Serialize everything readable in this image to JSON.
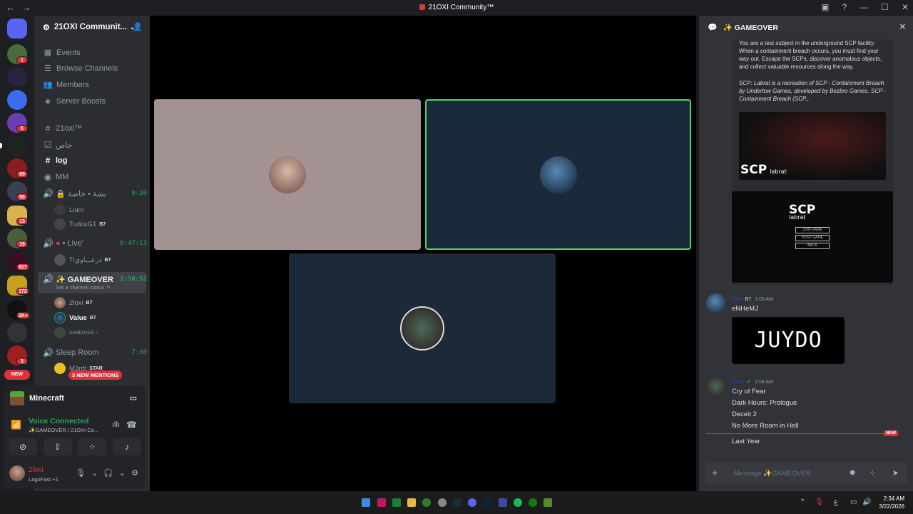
{
  "window": {
    "title": "21OXI Community™"
  },
  "guild_badges": [
    "1",
    "5",
    "69",
    "98",
    "13",
    "19",
    "827",
    "172",
    "1K+",
    "3"
  ],
  "new_pill": "NEW",
  "server": {
    "name": "21OXI Communit..."
  },
  "nav": [
    {
      "label": "Events"
    },
    {
      "label": "Browse Channels"
    },
    {
      "label": "Members"
    },
    {
      "label": "Server Boosts"
    }
  ],
  "channels": {
    "c1": {
      "label": "21oxi™"
    },
    "c2": {
      "label": "خاص"
    },
    "c3": {
      "label": "log"
    },
    "c4": {
      "label": "MM"
    },
    "v1": {
      "label": "بشة • خاصة",
      "time": "0:30"
    },
    "v2": {
      "label": "• Live'",
      "time": "6:47:13"
    },
    "v3": {
      "label": "✨ GAMEOVER",
      "time": "1:50:52",
      "status": "Set a channel status"
    },
    "v4": {
      "label": "Sleep Room",
      "time": "7:30"
    }
  },
  "voice_users": {
    "u1": {
      "name": "Liam"
    },
    "u2": {
      "name": "TurkixG1",
      "tag": "B7"
    },
    "u3": {
      "name": "درعـــاوي!؟",
      "tag": "B7"
    },
    "u4": {
      "name": "2loxi",
      "tag": "B7"
    },
    "u5": {
      "name": "Value",
      "tag": "B7"
    },
    "u6": {
      "name": "GAMEOVER ✓"
    },
    "u7": {
      "name": "M3rdt",
      "tag": "STAR"
    }
  },
  "mentions_pill": "3 NEW MENTIONS",
  "activity": {
    "game": "Minecraft"
  },
  "voice_connection": {
    "status": "Voice Connected",
    "location": "✨GAMEOVER / 21OXI Co..."
  },
  "user": {
    "name": "2loxi",
    "status": "LagoFast +1"
  },
  "chat": {
    "channel": "✨ GAMEOVER",
    "embed_text_1": "You are a test subject in the underground SCP facility. When a containment breach occurs, you must find your way out. Escape the SCPs, discover anomalous objects, and collect valuable resources along the way.",
    "embed_text_2": "SCP: Labrat is a recreation of SCP - Containment Breach by Undertow Games, developed by Bezbro Games. SCP - Containment Breach (SCP...",
    "logo_text": "SCP",
    "logo_sub": "labrat",
    "menu_items": [
      "JOIN GAME",
      "HOST GAME",
      "BACK"
    ],
    "messages": [
      {
        "author": "Hiro",
        "tag": "B7",
        "time": "1:03 AM",
        "lines": [
          "eNHeMJ"
        ],
        "image_text": "JUYDO"
      },
      {
        "author": "Zoro",
        "time": "2:04 AM",
        "lines": [
          "Cry of Fear",
          "Dark Hours: Prologue",
          "Deceit 2",
          "No More Room in Hell"
        ]
      }
    ],
    "new_tag": "NEW",
    "after_new": "Last Year",
    "placeholder": "Message ✨GAMEOVER"
  },
  "clock": {
    "time": "2:34 AM",
    "date": "3/22/2026"
  },
  "colors": {
    "accent": "#5865f2",
    "green": "#23a55a",
    "red": "#e0313a"
  }
}
